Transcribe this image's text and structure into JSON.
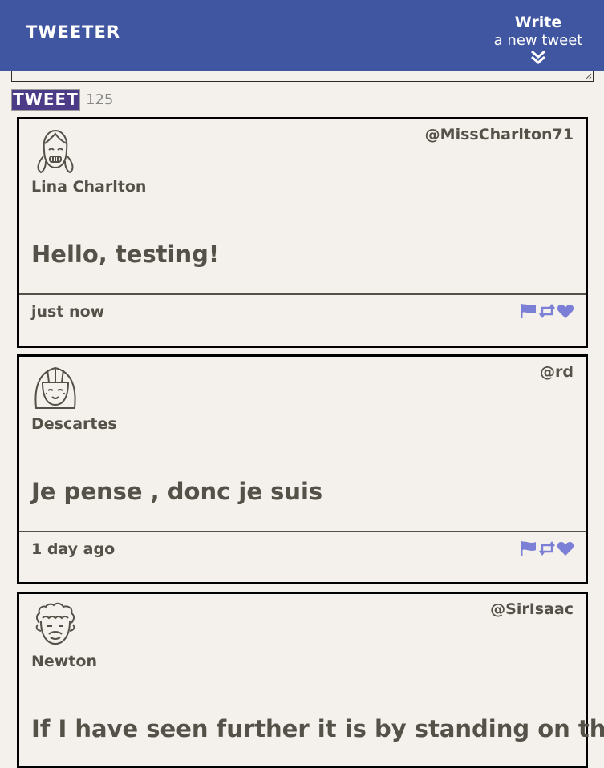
{
  "nav": {
    "brand": "TWEETER",
    "write_title": "Write",
    "write_subtitle": "a new tweet",
    "write_icon": "double-chevron-down-icon"
  },
  "compose": {
    "text": "",
    "button_label": "TWEET",
    "counter": "125"
  },
  "tweets": [
    {
      "name": "Lina Charlton",
      "handle": "@MissCharlton71",
      "avatar": "girl-pigtails-avatar",
      "content": "Hello, testing!",
      "time": "just now"
    },
    {
      "name": "Descartes",
      "handle": "@rd",
      "avatar": "bob-haircut-avatar",
      "content": "Je pense , donc je suis",
      "time": "1 day ago"
    },
    {
      "name": "Newton",
      "handle": "@SirIsaac",
      "avatar": "curly-hair-avatar",
      "content": "If I have seen further it is by standing on the"
    }
  ],
  "actions": [
    "flag-icon",
    "retweet-icon",
    "heart-icon"
  ],
  "colors": {
    "nav_bg": "#4056a1",
    "tweet_button": "#4c3b86",
    "action_icons": "#7b7fd6",
    "text": "#545149",
    "page_bg": "#f4f1ec"
  }
}
